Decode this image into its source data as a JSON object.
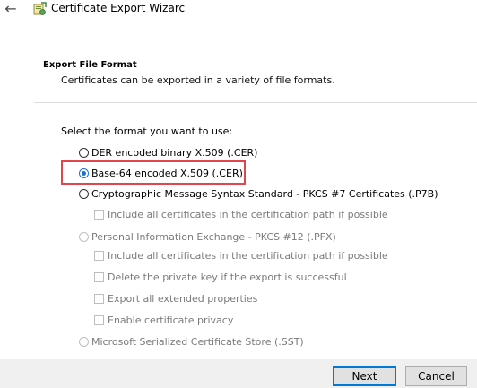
{
  "window": {
    "title": "Certificate Export Wizarc"
  },
  "header": {
    "section_title": "Export File Format",
    "section_subtitle": "Certificates can be exported in a variety of file formats."
  },
  "form": {
    "prompt": "Select the format you want to use:",
    "options": [
      {
        "label": "DER encoded binary X.509 (.CER)",
        "selected": false,
        "enabled": true
      },
      {
        "label": "Base-64 encoded X.509 (.CER)",
        "selected": true,
        "enabled": true
      },
      {
        "label": "Cryptographic Message Syntax Standard - PKCS #7 Certificates (.P7B)",
        "selected": false,
        "enabled": true
      },
      {
        "label": "Personal Information Exchange - PKCS #12 (.PFX)",
        "selected": false,
        "enabled": false
      },
      {
        "label": "Microsoft Serialized Certificate Store (.SST)",
        "selected": false,
        "enabled": false
      }
    ],
    "p7b_checkboxes": [
      {
        "label": "Include all certificates in the certification path if possible",
        "checked": false,
        "enabled": false
      }
    ],
    "pfx_checkboxes": [
      {
        "label": "Include all certificates in the certification path if possible",
        "checked": false,
        "enabled": false
      },
      {
        "label": "Delete the private key if the export is successful",
        "checked": false,
        "enabled": false
      },
      {
        "label": "Export all extended properties",
        "checked": false,
        "enabled": false
      },
      {
        "label": "Enable certificate privacy",
        "checked": false,
        "enabled": false
      }
    ]
  },
  "footer": {
    "next_label": "Next",
    "cancel_label": "Cancel"
  },
  "colors": {
    "accent": "#0078d7",
    "highlight": "#e0474c"
  },
  "icons": {
    "back": "back-arrow-icon",
    "wizard": "certificate-wizard-icon"
  }
}
